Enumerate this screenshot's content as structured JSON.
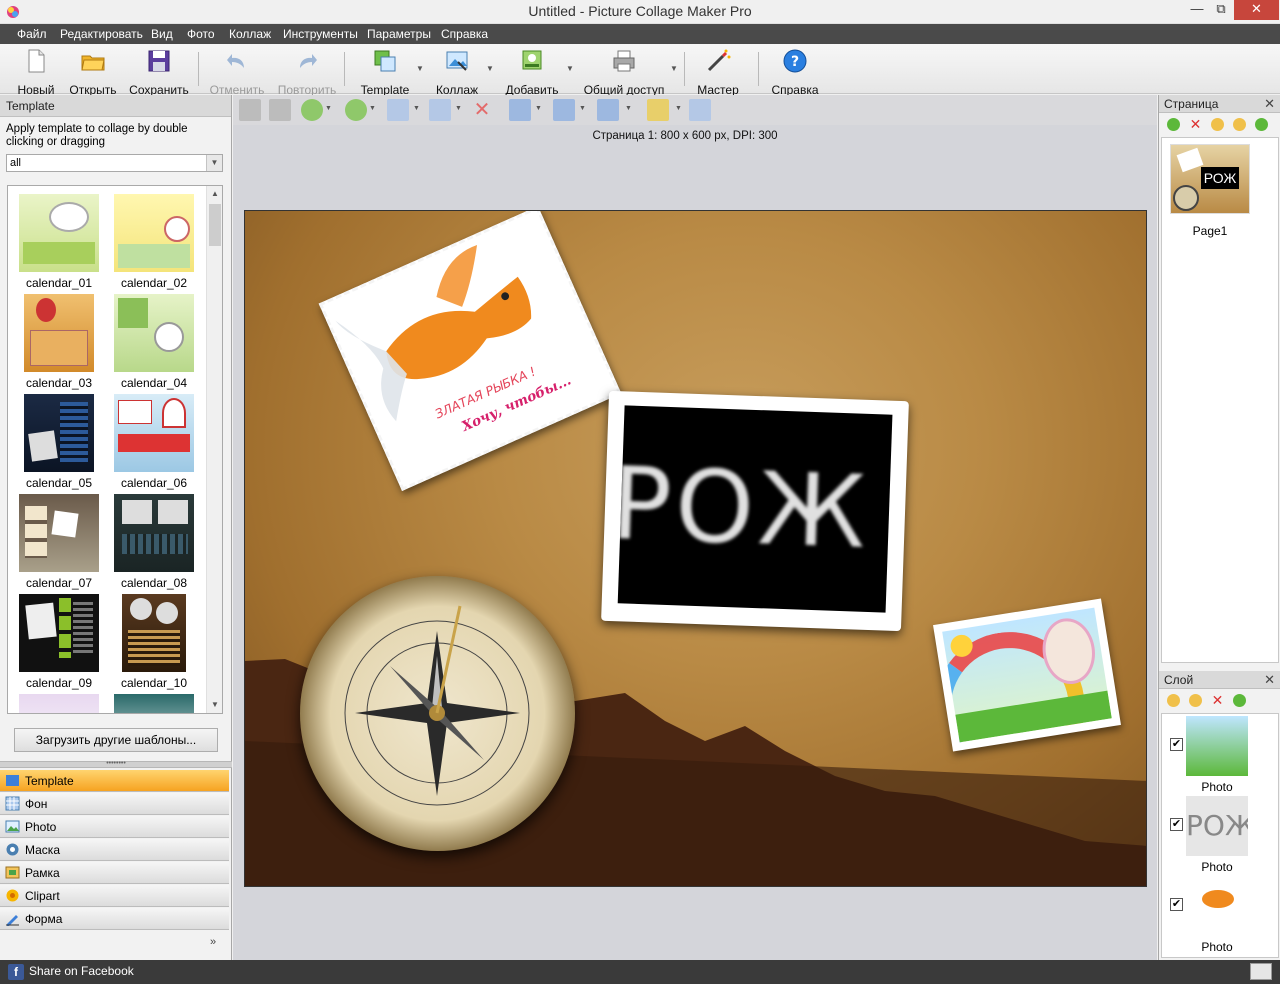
{
  "window": {
    "title": "Untitled - Picture Collage Maker Pro",
    "minimize": "—",
    "maximize": "⧉",
    "close": "✕"
  },
  "menu": [
    "Файл",
    "Редактировать",
    "Вид",
    "Фото",
    "Коллаж",
    "Инструменты",
    "Параметры",
    "Справка"
  ],
  "toolbar": {
    "new": "Новый",
    "open": "Открыть",
    "save": "Сохранить",
    "undo": "Отменить",
    "redo": "Повторить",
    "template": "Template",
    "collage": "Коллаж",
    "add": "Добавить",
    "share": "Общий доступ",
    "wizard": "Мастер",
    "help": "Справка"
  },
  "left_panel": {
    "title": "Template",
    "hint": "Apply template to collage by double clicking or dragging",
    "filter_value": "all",
    "templates": [
      "calendar_01",
      "calendar_02",
      "calendar_03",
      "calendar_04",
      "calendar_05",
      "calendar_06",
      "calendar_07",
      "calendar_08",
      "calendar_09",
      "calendar_10"
    ],
    "load_button": "Загрузить другие шаблоны...",
    "nav": [
      "Template",
      "Фон",
      "Photo",
      "Маска",
      "Рамка",
      "Clipart",
      "Форма"
    ],
    "nav_active": "Template",
    "more": "»"
  },
  "canvas": {
    "page_info": "Страница 1: 800 x 600 px, DPI: 300",
    "rozh_text": "РОЖ",
    "fish_caption_1": "ЗЛАТАЯ РЫБКА !",
    "fish_caption_2": "Хочу, чтобы..."
  },
  "pages_panel": {
    "title": "Страница",
    "pages": [
      "Page1"
    ]
  },
  "layers_panel": {
    "title": "Слой",
    "layers": [
      {
        "name": "Photo",
        "checked": "✔"
      },
      {
        "name": "Photo",
        "checked": "✔"
      },
      {
        "name": "Photo",
        "checked": "✔"
      }
    ]
  },
  "statusbar": {
    "facebook": "Share on Facebook"
  },
  "colors": {
    "menubar": "#4a4a4a",
    "active_tab": "#f6a321",
    "statusbar": "#3a3a3a"
  }
}
